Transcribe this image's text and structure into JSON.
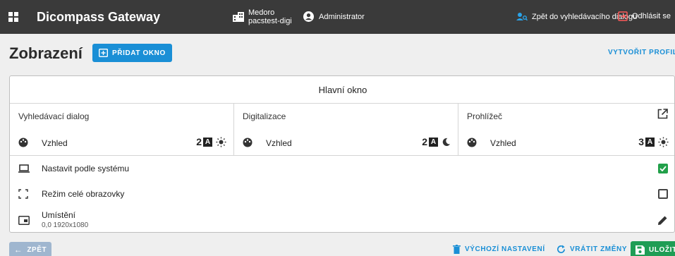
{
  "header": {
    "brand": "Dicompass Gateway",
    "site_name": "Medoro",
    "site_sub": "pacstest-digi",
    "user": "Administrator",
    "back_to_search": "Zpět do vyhledávacího dialogu",
    "logout": "Odhlásit se"
  },
  "page": {
    "title": "Zobrazení",
    "add_window": "PŘIDAT OKNO",
    "create_profile": "VYTVOŘIT PROFIL"
  },
  "card": {
    "window_title": "Hlavní okno",
    "columns": [
      {
        "title": "Vyhledávací dialog",
        "theme_label": "Vzhled",
        "theme_number": "2",
        "theme_letter": "A",
        "mode_icon": "sun-icon"
      },
      {
        "title": "Digitalizace",
        "theme_label": "Vzhled",
        "theme_number": "2",
        "theme_letter": "A",
        "mode_icon": "moon-icon"
      },
      {
        "title": "Prohlížeč",
        "theme_label": "Vzhled",
        "theme_number": "3",
        "theme_letter": "A",
        "mode_icon": "sun-icon"
      }
    ],
    "options": {
      "system": {
        "label": "Nastavit podle systému",
        "checked": true
      },
      "fullscreen": {
        "label": "Režim celé obrazovky",
        "checked": false
      },
      "position": {
        "label": "Umístění",
        "value": "0,0 1920x1080"
      }
    }
  },
  "footer": {
    "back": "ZPĚT",
    "defaults": "VÝCHOZÍ NASTAVENÍ",
    "revert": "VRÁTIT ZMĚNY",
    "save": "ULOŽIT"
  },
  "colors": {
    "accent": "#1a8fd6",
    "save": "#1f9d55",
    "checked": "#22a04a",
    "topbar": "#3a3a3a"
  }
}
